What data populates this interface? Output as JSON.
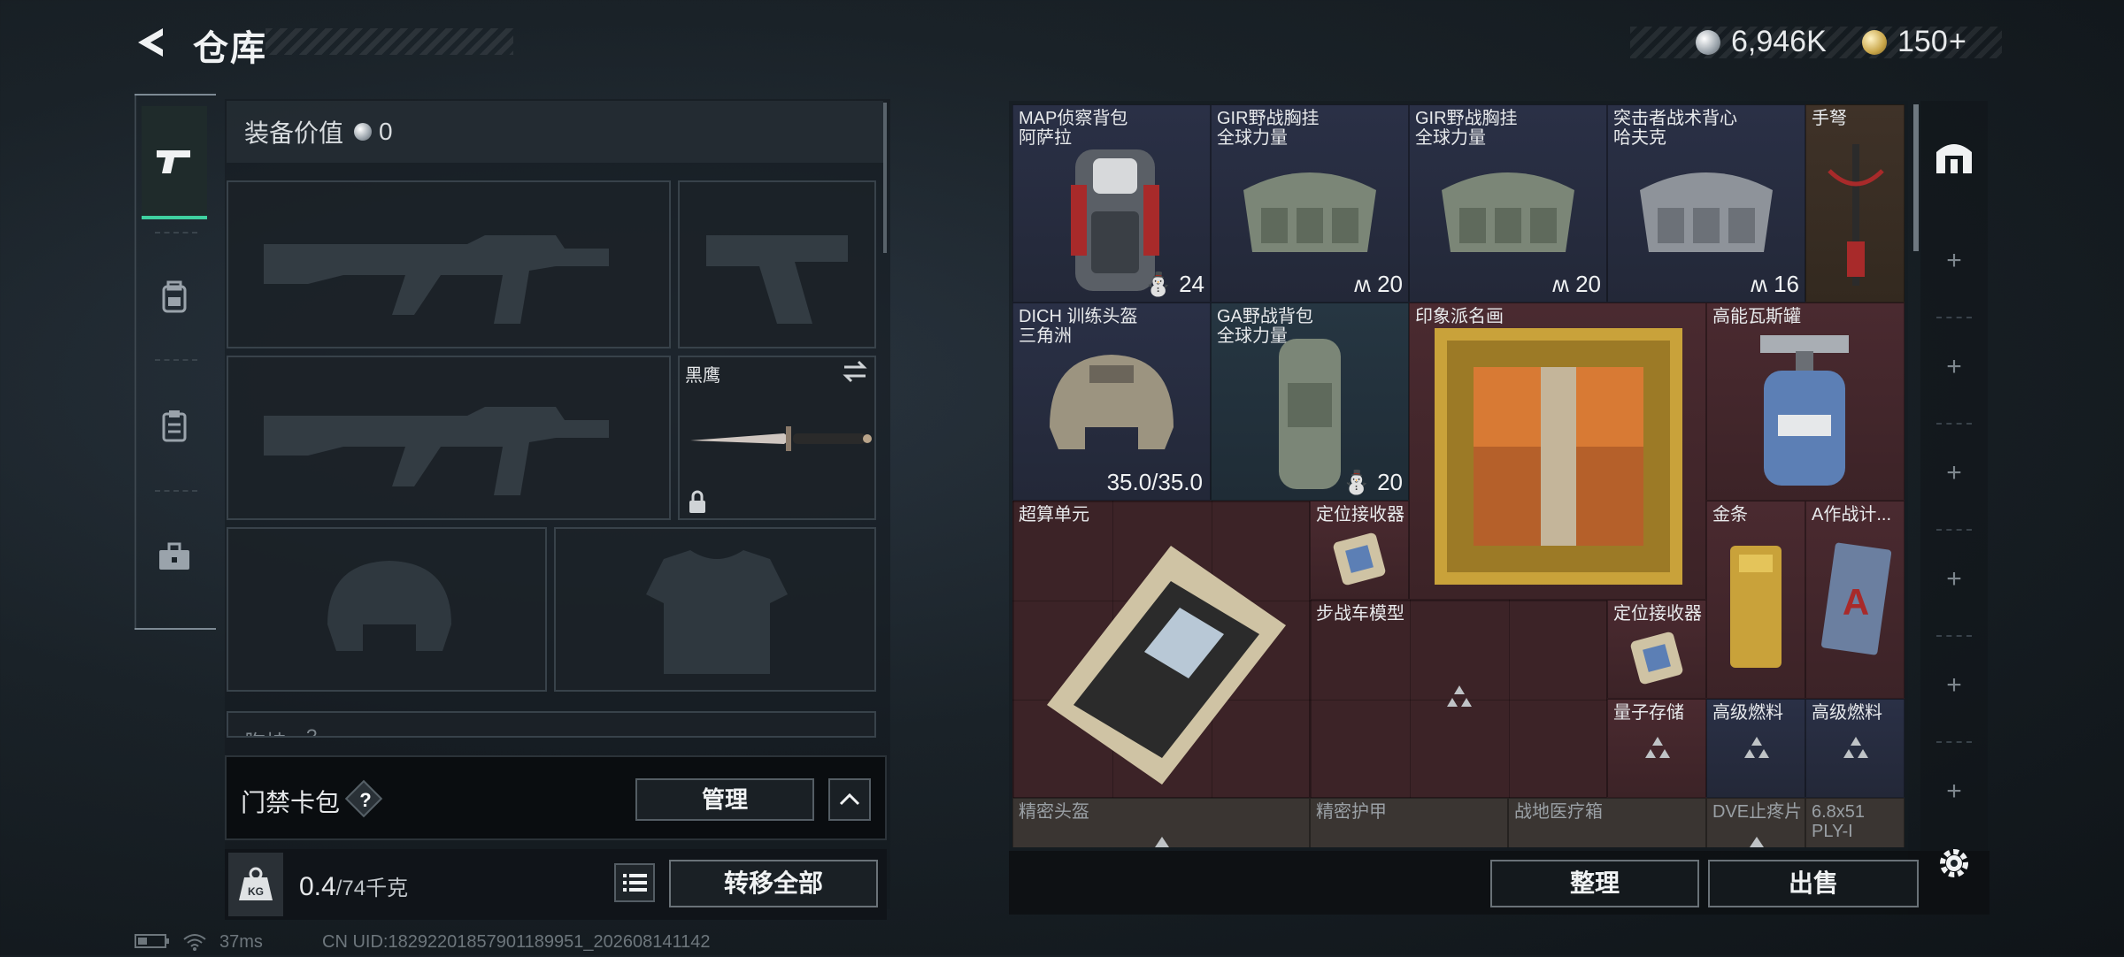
{
  "header": {
    "title": "仓库",
    "currency_silver": "6,946K",
    "currency_gold": "150",
    "gold_add": "+"
  },
  "equip": {
    "value_label": "装备价值",
    "value": "0",
    "knife_name": "黑鹰",
    "next_section_label": "胸挂",
    "next_section_hint": "?"
  },
  "cardpack": {
    "label": "门禁卡包",
    "help": "?",
    "manage": "管理"
  },
  "weight": {
    "current": "0.4",
    "capacity": "/74千克",
    "transfer": "转移全部"
  },
  "status": {
    "ping": "37ms",
    "uid": "CN UID:18292201857901189951_202608141142"
  },
  "grid": {
    "items": [
      {
        "id": "map-backpack",
        "name": "MAP侦察背包\n阿萨拉",
        "capacity": "24"
      },
      {
        "id": "gir-chestrig-1",
        "name": "GIR野战胸挂\n全球力量",
        "capacity": "20"
      },
      {
        "id": "gir-chestrig-2",
        "name": "GIR野战胸挂\n全球力量",
        "capacity": "20"
      },
      {
        "id": "assault-vest",
        "name": "突击者战术背心\n哈夫克",
        "capacity": "16"
      },
      {
        "id": "crossbow",
        "name": "手弩"
      },
      {
        "id": "dich-helmet",
        "name": "DICH 训练头盔\n三角洲",
        "durability": "35.0/35.0"
      },
      {
        "id": "ga-backpack",
        "name": "GA野战背包\n全球力量",
        "capacity": "20"
      },
      {
        "id": "painting",
        "name": "印象派名画"
      },
      {
        "id": "gas-tank",
        "name": "高能瓦斯罐"
      },
      {
        "id": "supercomputer",
        "name": "超算单元"
      },
      {
        "id": "locator-1",
        "name": "定位接收器"
      },
      {
        "id": "gold-bar",
        "name": "金条"
      },
      {
        "id": "a-tactical",
        "name": "A作战计..."
      },
      {
        "id": "ifv-model",
        "name": "步战车模型"
      },
      {
        "id": "locator-2",
        "name": "定位接收器"
      },
      {
        "id": "quantum-storage",
        "name": "量子存储"
      },
      {
        "id": "fuel-1",
        "name": "高级燃料"
      },
      {
        "id": "fuel-2",
        "name": "高级燃料"
      },
      {
        "id": "precision-helmet",
        "name": "精密头盔"
      },
      {
        "id": "precision-armor",
        "name": "精密护甲"
      },
      {
        "id": "field-medkit",
        "name": "战地医疗箱"
      },
      {
        "id": "dve-painkiller",
        "name": "DVE止疼片"
      },
      {
        "id": "ammo",
        "name": "6.8x51\nPLY-I"
      }
    ]
  },
  "actions": {
    "sort": "整理",
    "sell": "出售"
  },
  "colors": {
    "accent": "#3fd0a0",
    "rare_red": "#4a2a30",
    "rare_blue": "#2a3046"
  }
}
